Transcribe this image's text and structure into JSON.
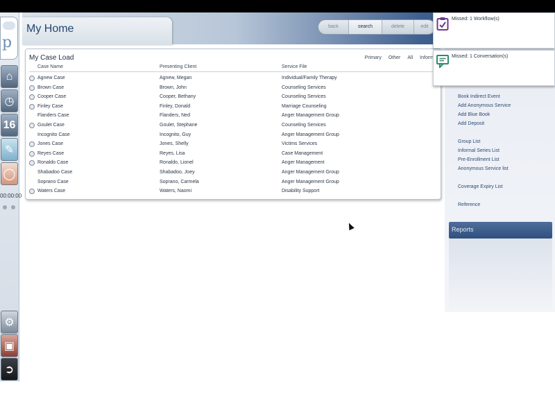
{
  "app": {
    "logo_text": "p",
    "timer": "00:00:00"
  },
  "header": {
    "title": "My Home",
    "nav_buttons": [
      {
        "label": "back",
        "active": false
      },
      {
        "label": "search",
        "active": true
      },
      {
        "label": "delete",
        "active": false
      },
      {
        "label": "edit",
        "active": false
      }
    ]
  },
  "caseload": {
    "title": "My Case Load",
    "filters": [
      "Primary",
      "Other",
      "All",
      "Inform"
    ],
    "columns": [
      "Case Name",
      "Presenting Client",
      "Service File"
    ],
    "rows": [
      {
        "case": "Agnew Case",
        "client": "Agnew, Megan",
        "service": "Individual/Family Therapy",
        "gear": true
      },
      {
        "case": "Brown Case",
        "client": "Brown, John",
        "service": "Counseling Services",
        "gear": true
      },
      {
        "case": "Cooper Case",
        "client": "Cooper, Bethany",
        "service": "Counseling Services",
        "gear": true
      },
      {
        "case": "Finley Case",
        "client": "Finley, Donald",
        "service": "Marriage Counseling",
        "gear": true
      },
      {
        "case": "Flanders Case",
        "client": "Flanders, Ned",
        "service": "Anger Management Group",
        "gear": false
      },
      {
        "case": "Goulet Case",
        "client": "Goulet, Stephane",
        "service": "Counseling Services",
        "gear": true
      },
      {
        "case": "Incognito Case",
        "client": "Incognito, Guy",
        "service": "Anger Management Group",
        "gear": false
      },
      {
        "case": "Jones Case",
        "client": "Jones, Shelly",
        "service": "Victims Services",
        "gear": true
      },
      {
        "case": "Reyes Case",
        "client": "Reyes, Lisa",
        "service": "Case Management",
        "gear": true
      },
      {
        "case": "Ronaldo Case",
        "client": "Ronaldo, Lionel",
        "service": "Anger Management",
        "gear": true
      },
      {
        "case": "Shabadoo Case",
        "client": "Shabadoo, Joey",
        "service": "Anger Management Group",
        "gear": false
      },
      {
        "case": "Soprano Case",
        "client": "Soprano, Carmela",
        "service": "Anger Management Group",
        "gear": false
      },
      {
        "case": "Waters Case",
        "client": "Waters, Naomi",
        "service": "Disability Support",
        "gear": true
      }
    ]
  },
  "sidebar": {
    "links": [
      "Book Indirect Event",
      "Add Anonymous Service",
      "Add Blue Book",
      "Add Deposit",
      "Group List",
      "Informal Series List",
      "Pre-Enrollment List",
      "Anonymous Service list",
      "Coverage Expiry List",
      "Reference"
    ],
    "reports_label": "Reports"
  },
  "notifications": [
    {
      "text": "Missed: 1 Workflow(s)",
      "icon": "clipboard-check-icon",
      "color": "#6b3a8c"
    },
    {
      "text": "Missed: 1 Conversation(s)",
      "icon": "chat-bubble-icon",
      "color": "#2f8a6c"
    }
  ]
}
